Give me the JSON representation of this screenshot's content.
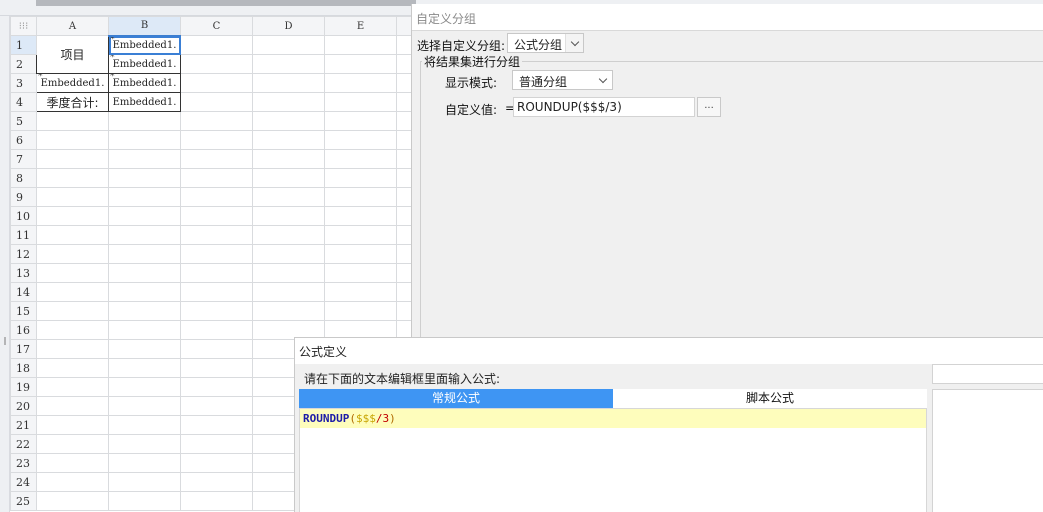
{
  "sheet": {
    "columns": [
      "A",
      "B",
      "C",
      "D",
      "E"
    ],
    "rows": [
      "1",
      "2",
      "3",
      "4",
      "5",
      "6",
      "7",
      "8",
      "9",
      "10",
      "11",
      "12",
      "13",
      "14",
      "15",
      "16",
      "17",
      "18",
      "19",
      "20",
      "21",
      "22",
      "23",
      "24",
      "25"
    ],
    "cells": {
      "A1": "项目",
      "B1": "Embedded1.",
      "B2": "Embedded1.",
      "A3": "Embedded1.",
      "B3": "Embedded1.",
      "A4": "季度合计:",
      "B4": "Embedded1."
    }
  },
  "group_panel": {
    "title": "自定义分组",
    "select_label": "选择自定义分组:",
    "select_value": "公式分组",
    "section_title": "将结果集进行分组",
    "display_mode_label": "显示模式:",
    "display_mode_value": "普通分组",
    "custom_value_label": "自定义值:",
    "equals": "=",
    "custom_value": "ROUNDUP($$$/3)",
    "browse_button": "..."
  },
  "formula_dialog": {
    "title": "公式定义",
    "prompt": "请在下面的文本编辑框里面输入公式:",
    "tab_regular": "常规公式",
    "tab_script": "脚本公式",
    "code": {
      "fn": "ROUNDUP",
      "open": "(",
      "arg": "$$$",
      "op": "/",
      "num": "3",
      "close": ")"
    }
  }
}
